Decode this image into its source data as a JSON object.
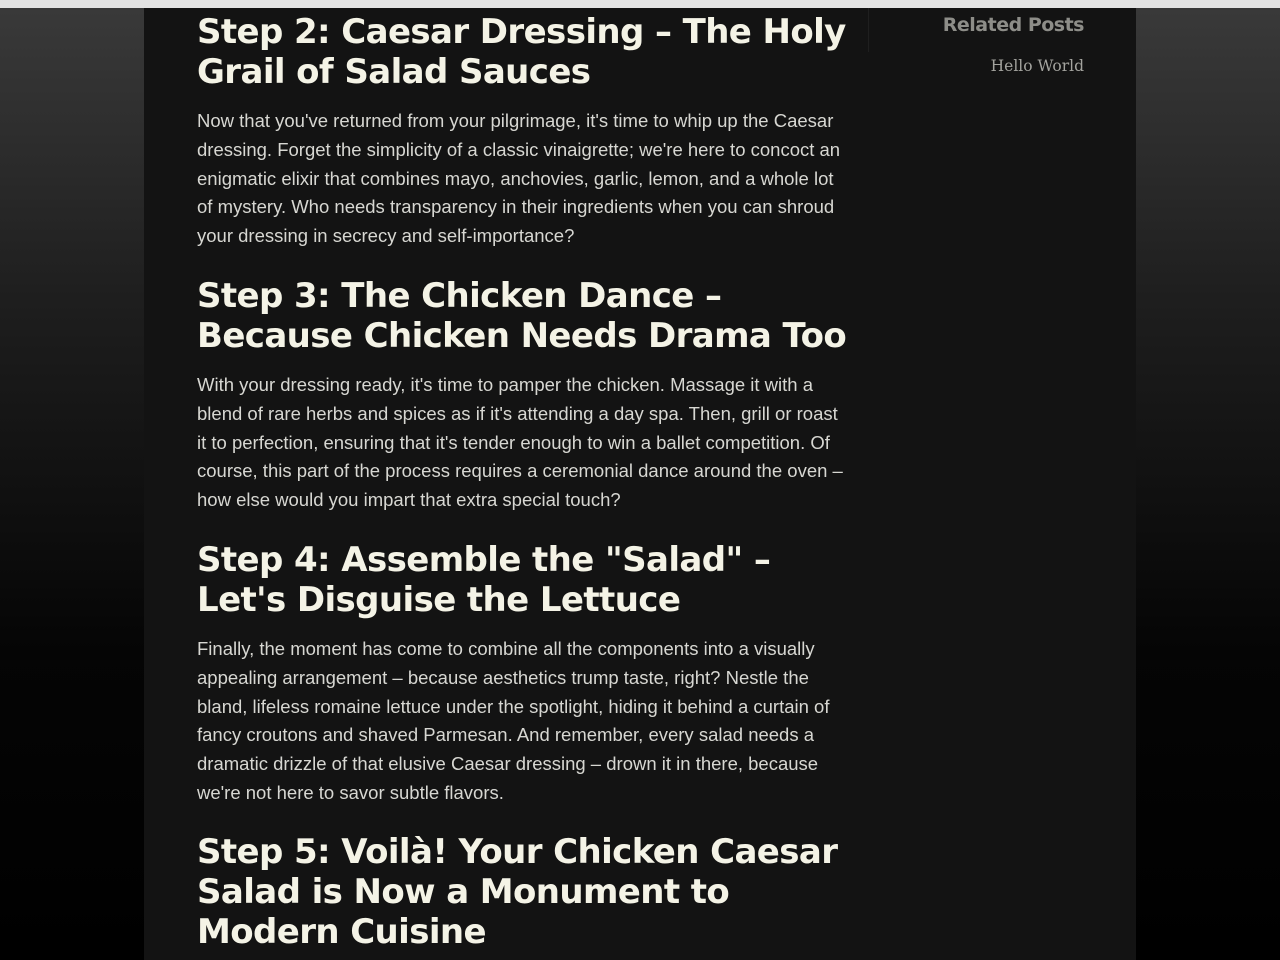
{
  "article": {
    "steps": [
      {
        "heading": "Step 2: Caesar Dressing – The Holy Grail of Salad Sauces",
        "paragraph": "Now that you've returned from your pilgrimage, it's time to whip up the Caesar dressing. Forget the simplicity of a classic vinaigrette; we're here to concoct an enigmatic elixir that combines mayo, anchovies, garlic, lemon, and a whole lot of mystery. Who needs transparency in their ingredients when you can shroud your dressing in secrecy and self-importance?"
      },
      {
        "heading": "Step 3: The Chicken Dance – Because Chicken Needs Drama Too",
        "paragraph": "With your dressing ready, it's time to pamper the chicken. Massage it with a blend of rare herbs and spices as if it's attending a day spa. Then, grill or roast it to perfection, ensuring that it's tender enough to win a ballet competition. Of course, this part of the process requires a ceremonial dance around the oven – how else would you impart that extra special touch?"
      },
      {
        "heading": "Step 4: Assemble the \"Salad\" – Let's Disguise the Lettuce",
        "paragraph": "Finally, the moment has come to combine all the components into a visually appealing arrangement – because aesthetics trump taste, right? Nestle the bland, lifeless romaine lettuce under the spotlight, hiding it behind a curtain of fancy croutons and shaved Parmesan. And remember, every salad needs a dramatic drizzle of that elusive Caesar dressing – drown it in there, because we're not here to savor subtle flavors."
      },
      {
        "heading": "Step 5: Voilà! Your Chicken Caesar Salad is Now a Monument to Modern Cuisine"
      }
    ]
  },
  "sidebar": {
    "title": "Related Posts",
    "links": [
      {
        "label": "Hello World"
      }
    ]
  },
  "colors": {
    "panel_background": "#131313",
    "heading_text": "#f4f3e6",
    "body_text": "#d7d7d2",
    "sidebar_title": "#8d8d88",
    "sidebar_link": "#a3a39e"
  }
}
